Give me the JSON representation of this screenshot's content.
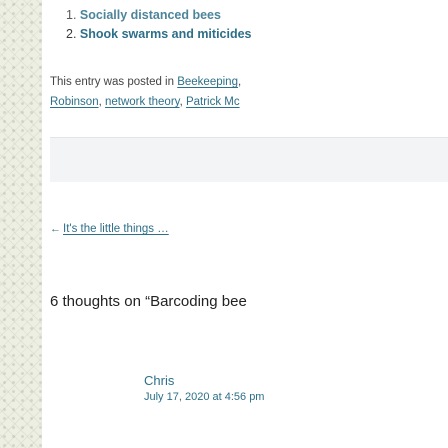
{
  "related_posts": [
    {
      "number": "1.",
      "title": "Socially distanced bees"
    },
    {
      "number": "2.",
      "title": "Shook swarms and miticides"
    }
  ],
  "entry_meta": {
    "prefix": "This entry was posted in",
    "links": [
      "Beekeeping",
      "Robinson",
      "network theory",
      "Patrick Mc"
    ]
  },
  "post_navigation": {
    "prev_arrow": "←",
    "prev_label": "It's the little things …"
  },
  "comments": {
    "title": "6 thoughts on “Barcoding bee",
    "items": [
      {
        "author": "Chris",
        "date": "July 17, 2020 at 4:56 pm"
      }
    ]
  },
  "colors": {
    "link": "#2d6f89",
    "text": "#444444",
    "pattern_bg": "#ecefe2"
  }
}
